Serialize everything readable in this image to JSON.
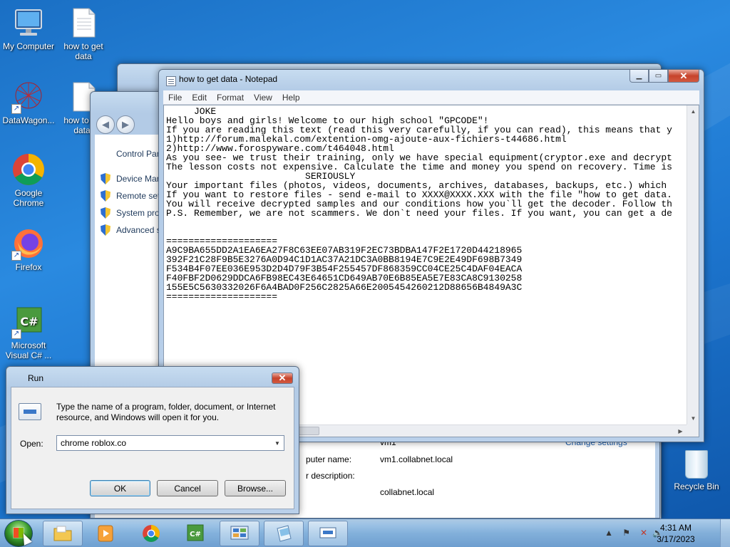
{
  "desktop": {
    "icons": [
      {
        "label": "My Computer"
      },
      {
        "label": "how to get data"
      },
      {
        "label": "DataWagon..."
      },
      {
        "label": "how to get data("
      },
      {
        "label": "Google Chrome"
      },
      {
        "label": "Firefox"
      },
      {
        "label": "Microsoft Visual C# ..."
      },
      {
        "label": "Recycle Bin"
      }
    ]
  },
  "control_panel": {
    "links": [
      "Device Man",
      "Remote set",
      "System pro",
      "Advanced s"
    ],
    "home_label": "Control Pan",
    "change_settings": "Change settings",
    "details": [
      {
        "label": "puter name:",
        "value": "vm1.collabnet.local"
      },
      {
        "label": "r description:",
        "value": ""
      },
      {
        "label": "",
        "value": "collabnet.local"
      }
    ],
    "vm_label": "vm1",
    "name_label": "puter name:"
  },
  "notepad": {
    "title": "how to get data - Notepad",
    "menu": [
      "File",
      "Edit",
      "Format",
      "View",
      "Help"
    ],
    "content": "     JOKE\nHello boys and girls! Welcome to our high school \"GPCODE\"!\nIf you are reading this text (read this very carefully, if you can read), this means that y\n1)http://forum.malekal.com/extention-omg-ajoute-aux-fichiers-t44686.html\n2)http://www.forospyware.com/t464048.html\nAs you see- we trust their training, only we have special equipment(cryptor.exe and decrypt\nThe lesson costs not expensive. Calculate the time and money you spend on recovery. Time is\n                         SERIOUSLY\nYour important files (photos, videos, documents, archives, databases, backups, etc.) which \nIf you want to restore files - send e-mail to XXXX@XXXX.XXX with the file \"how to get data.\nYou will receive decrypted samples and our conditions how you`ll get the decoder. Follow th\nP.S. Remember, we are not scammers. We don`t need your files. If you want, you can get a de\n\n\n====================\nA9C9BA655DD2A1EA6EA27F8C63EE07AB319F2EC73BDBA147F2E1720D44218965\n392F21C28F9B5E3276A0D94C1D1AC37A21DC3A0BB8194E7C9E2E49DF698B7349\nF534B4F07EE036E953D2D4D79F3B54F255457DF868359CC04CE25C4DAF04EACA\nF40FBF2D0629DDCA6FB98EC43E64651CD649AB70E6B85EA5E7E83CA8C9130258\n155E5C5630332026F6A4BAD0F256C2825A66E2005454260212D88656B4849A3C\n===================="
  },
  "run_dialog": {
    "title": "Run",
    "description": "Type the name of a program, folder, document, or Internet resource, and Windows will open it for you.",
    "open_label": "Open:",
    "input_value": "chrome roblox.co",
    "ok_label": "OK",
    "cancel_label": "Cancel",
    "browse_label": "Browse..."
  },
  "taskbar": {
    "time": "4:31 AM",
    "date": "3/17/2023"
  },
  "icon_names": {
    "start": "windows-start-orb",
    "explorer": "folder-icon",
    "media": "media-player-icon",
    "chrome": "chrome-icon",
    "csharp": "visual-csharp-icon",
    "control": "control-panel-icon",
    "notepad": "notepad-icon",
    "run": "run-icon"
  }
}
